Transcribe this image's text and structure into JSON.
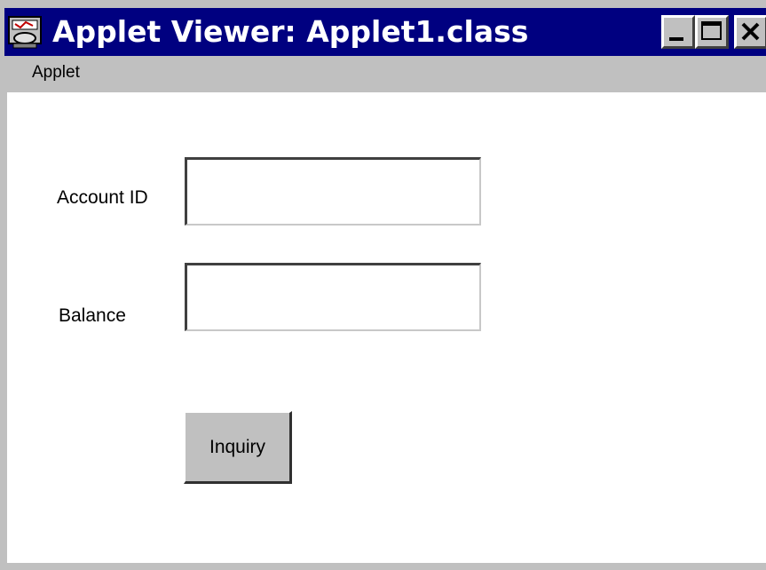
{
  "window": {
    "title": "Applet Viewer: Applet1.class",
    "icon": "applet-viewer-icon",
    "controls": {
      "minimize": "minimize-icon",
      "maximize": "maximize-icon",
      "close": "close-icon"
    }
  },
  "menubar": {
    "items": [
      {
        "label": "Applet"
      }
    ]
  },
  "form": {
    "account_id": {
      "label": "Account ID",
      "value": ""
    },
    "balance": {
      "label": "Balance",
      "value": ""
    },
    "inquiry_button": {
      "label": "Inquiry"
    }
  },
  "colors": {
    "titlebar": "#000080",
    "chrome": "#c0c0c0",
    "content": "#ffffff"
  }
}
